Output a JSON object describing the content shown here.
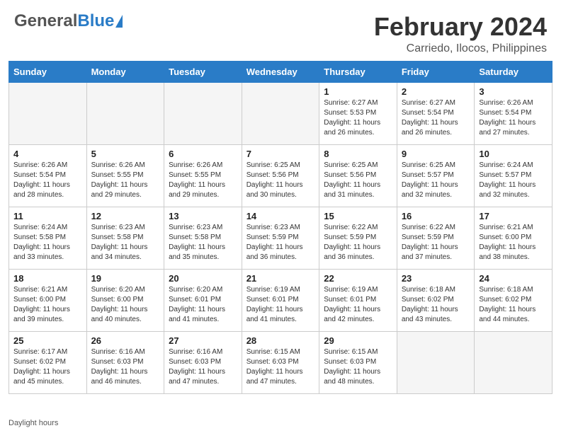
{
  "header": {
    "logo_general": "General",
    "logo_blue": "Blue",
    "title": "February 2024",
    "subtitle": "Carriedo, Ilocos, Philippines"
  },
  "days_of_week": [
    "Sunday",
    "Monday",
    "Tuesday",
    "Wednesday",
    "Thursday",
    "Friday",
    "Saturday"
  ],
  "weeks": [
    [
      {
        "num": "",
        "info": "",
        "empty": true
      },
      {
        "num": "",
        "info": "",
        "empty": true
      },
      {
        "num": "",
        "info": "",
        "empty": true
      },
      {
        "num": "",
        "info": "",
        "empty": true
      },
      {
        "num": "1",
        "info": "Sunrise: 6:27 AM\nSunset: 5:53 PM\nDaylight: 11 hours\nand 26 minutes."
      },
      {
        "num": "2",
        "info": "Sunrise: 6:27 AM\nSunset: 5:54 PM\nDaylight: 11 hours\nand 26 minutes."
      },
      {
        "num": "3",
        "info": "Sunrise: 6:26 AM\nSunset: 5:54 PM\nDaylight: 11 hours\nand 27 minutes."
      }
    ],
    [
      {
        "num": "4",
        "info": "Sunrise: 6:26 AM\nSunset: 5:54 PM\nDaylight: 11 hours\nand 28 minutes."
      },
      {
        "num": "5",
        "info": "Sunrise: 6:26 AM\nSunset: 5:55 PM\nDaylight: 11 hours\nand 29 minutes."
      },
      {
        "num": "6",
        "info": "Sunrise: 6:26 AM\nSunset: 5:55 PM\nDaylight: 11 hours\nand 29 minutes."
      },
      {
        "num": "7",
        "info": "Sunrise: 6:25 AM\nSunset: 5:56 PM\nDaylight: 11 hours\nand 30 minutes."
      },
      {
        "num": "8",
        "info": "Sunrise: 6:25 AM\nSunset: 5:56 PM\nDaylight: 11 hours\nand 31 minutes."
      },
      {
        "num": "9",
        "info": "Sunrise: 6:25 AM\nSunset: 5:57 PM\nDaylight: 11 hours\nand 32 minutes."
      },
      {
        "num": "10",
        "info": "Sunrise: 6:24 AM\nSunset: 5:57 PM\nDaylight: 11 hours\nand 32 minutes."
      }
    ],
    [
      {
        "num": "11",
        "info": "Sunrise: 6:24 AM\nSunset: 5:58 PM\nDaylight: 11 hours\nand 33 minutes."
      },
      {
        "num": "12",
        "info": "Sunrise: 6:23 AM\nSunset: 5:58 PM\nDaylight: 11 hours\nand 34 minutes."
      },
      {
        "num": "13",
        "info": "Sunrise: 6:23 AM\nSunset: 5:58 PM\nDaylight: 11 hours\nand 35 minutes."
      },
      {
        "num": "14",
        "info": "Sunrise: 6:23 AM\nSunset: 5:59 PM\nDaylight: 11 hours\nand 36 minutes."
      },
      {
        "num": "15",
        "info": "Sunrise: 6:22 AM\nSunset: 5:59 PM\nDaylight: 11 hours\nand 36 minutes."
      },
      {
        "num": "16",
        "info": "Sunrise: 6:22 AM\nSunset: 5:59 PM\nDaylight: 11 hours\nand 37 minutes."
      },
      {
        "num": "17",
        "info": "Sunrise: 6:21 AM\nSunset: 6:00 PM\nDaylight: 11 hours\nand 38 minutes."
      }
    ],
    [
      {
        "num": "18",
        "info": "Sunrise: 6:21 AM\nSunset: 6:00 PM\nDaylight: 11 hours\nand 39 minutes."
      },
      {
        "num": "19",
        "info": "Sunrise: 6:20 AM\nSunset: 6:00 PM\nDaylight: 11 hours\nand 40 minutes."
      },
      {
        "num": "20",
        "info": "Sunrise: 6:20 AM\nSunset: 6:01 PM\nDaylight: 11 hours\nand 41 minutes."
      },
      {
        "num": "21",
        "info": "Sunrise: 6:19 AM\nSunset: 6:01 PM\nDaylight: 11 hours\nand 41 minutes."
      },
      {
        "num": "22",
        "info": "Sunrise: 6:19 AM\nSunset: 6:01 PM\nDaylight: 11 hours\nand 42 minutes."
      },
      {
        "num": "23",
        "info": "Sunrise: 6:18 AM\nSunset: 6:02 PM\nDaylight: 11 hours\nand 43 minutes."
      },
      {
        "num": "24",
        "info": "Sunrise: 6:18 AM\nSunset: 6:02 PM\nDaylight: 11 hours\nand 44 minutes."
      }
    ],
    [
      {
        "num": "25",
        "info": "Sunrise: 6:17 AM\nSunset: 6:02 PM\nDaylight: 11 hours\nand 45 minutes."
      },
      {
        "num": "26",
        "info": "Sunrise: 6:16 AM\nSunset: 6:03 PM\nDaylight: 11 hours\nand 46 minutes."
      },
      {
        "num": "27",
        "info": "Sunrise: 6:16 AM\nSunset: 6:03 PM\nDaylight: 11 hours\nand 47 minutes."
      },
      {
        "num": "28",
        "info": "Sunrise: 6:15 AM\nSunset: 6:03 PM\nDaylight: 11 hours\nand 47 minutes."
      },
      {
        "num": "29",
        "info": "Sunrise: 6:15 AM\nSunset: 6:03 PM\nDaylight: 11 hours\nand 48 minutes."
      },
      {
        "num": "",
        "info": "",
        "empty": true
      },
      {
        "num": "",
        "info": "",
        "empty": true
      }
    ]
  ],
  "footer": {
    "daylight_label": "Daylight hours"
  }
}
